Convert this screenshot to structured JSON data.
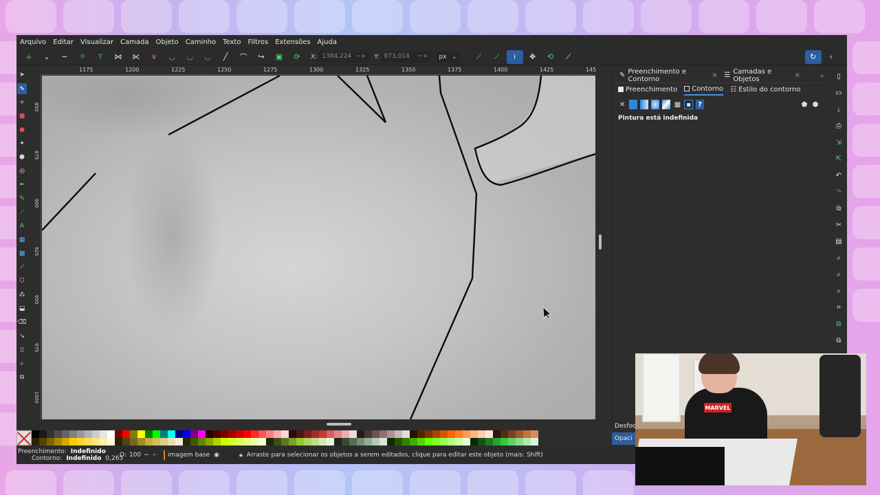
{
  "menu": [
    "Arquivo",
    "Editar",
    "Visualizar",
    "Camada",
    "Objeto",
    "Caminho",
    "Texto",
    "Filtros",
    "Extensões",
    "Ajuda"
  ],
  "toolbar": {
    "x_label": "X:",
    "x_value": "1384,224",
    "y_label": "Y:",
    "y_value": "873,014",
    "unit": "px"
  },
  "ruler": {
    "h_labels": [
      "1175",
      "1200",
      "1225",
      "1250",
      "1275",
      "1300",
      "1325",
      "1350",
      "1375",
      "1400",
      "1425",
      "145"
    ],
    "v_labels": [
      "850",
      "875",
      "900",
      "925",
      "950",
      "975",
      "1000"
    ]
  },
  "panel": {
    "tabs": [
      {
        "label": "Preenchimento e Contorno",
        "close": "×"
      },
      {
        "label": "Camadas e Objetos",
        "close": "×"
      }
    ],
    "subtabs": [
      "Preenchimento",
      "Contorno",
      "Estilo do contorno"
    ],
    "paint_unset_label": "?",
    "status": "Pintura está indefinida",
    "blur_label": "Desfoq",
    "opacity_label": "Opaci"
  },
  "status": {
    "fill_label": "Preenchimento:",
    "fill_value": "Indefinido",
    "stroke_label": "Contorno:",
    "stroke_value": "Indefinido",
    "stroke_width": "0,265",
    "opacity_label": "O:",
    "opacity_value": "100",
    "layer_name": "imagem base",
    "message": "Arraste para selecionar os objetos a serem editados, clique para editar este objeto (mais: Shift)"
  },
  "webcam": {
    "shirt_text": "MARVEL"
  },
  "colors": {
    "accent": "#2c5ea0",
    "toolbar_green": "#49d36b",
    "toolbar_pink": "#e26bd2"
  }
}
